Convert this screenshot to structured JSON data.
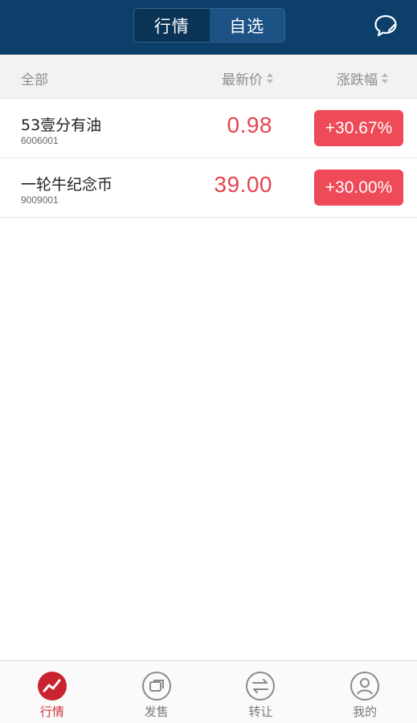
{
  "top_tabs": [
    {
      "label": "行情",
      "active": true
    },
    {
      "label": "自选",
      "active": false
    }
  ],
  "header": {
    "all_label": "全部",
    "price_label": "最新价",
    "change_label": "涨跌幅"
  },
  "rows": [
    {
      "name": "53壹分有油",
      "code": "6006001",
      "price": "0.98",
      "change": "+30.67%"
    },
    {
      "name": "一轮牛纪念币",
      "code": "9009001",
      "price": "39.00",
      "change": "+30.00%"
    }
  ],
  "bottom_nav": [
    {
      "label": "行情",
      "icon": "market-trend-icon",
      "active": true
    },
    {
      "label": "发售",
      "icon": "sale-icon",
      "active": false
    },
    {
      "label": "转让",
      "icon": "transfer-icon",
      "active": false
    },
    {
      "label": "我的",
      "icon": "profile-icon",
      "active": false
    }
  ],
  "colors": {
    "topbar": "#0d3f6b",
    "up_red": "#ef4a58",
    "price_red": "#e8424f",
    "nav_active": "#d0303d"
  }
}
